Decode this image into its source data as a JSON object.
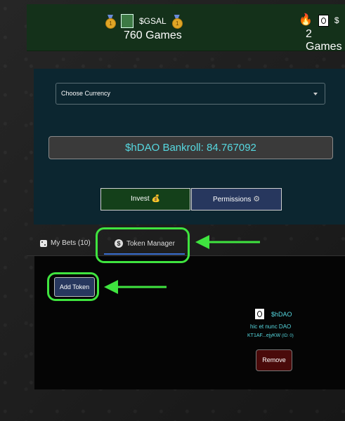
{
  "stats": [
    {
      "label": "$GSAL",
      "count": "760 Games",
      "icon": "token-image-icon"
    },
    {
      "label": "$",
      "count": "2 Games",
      "icon": "hic-et-nunc-logo-icon"
    }
  ],
  "currency": {
    "label": "Choose Currency"
  },
  "bankroll": {
    "text": "$hDAO Bankroll: 84.767092"
  },
  "buttons": {
    "invest": "Invest",
    "permissions": "Permissions"
  },
  "tabs": {
    "my_bets": "My Bets (10)",
    "token_manager": "Token Manager"
  },
  "token_manager": {
    "add_token": "Add Token",
    "token": {
      "symbol": "$hDAO",
      "name": "hic et nunc DAO",
      "address": "KT1AF...ejyKW",
      "id": "(ID: 0)",
      "remove": "Remove"
    }
  },
  "colors": {
    "accent_cyan": "#56d8e0",
    "highlight_green": "#3fe43f",
    "invest_green": "#14401a",
    "permissions_blue": "#27375e"
  }
}
